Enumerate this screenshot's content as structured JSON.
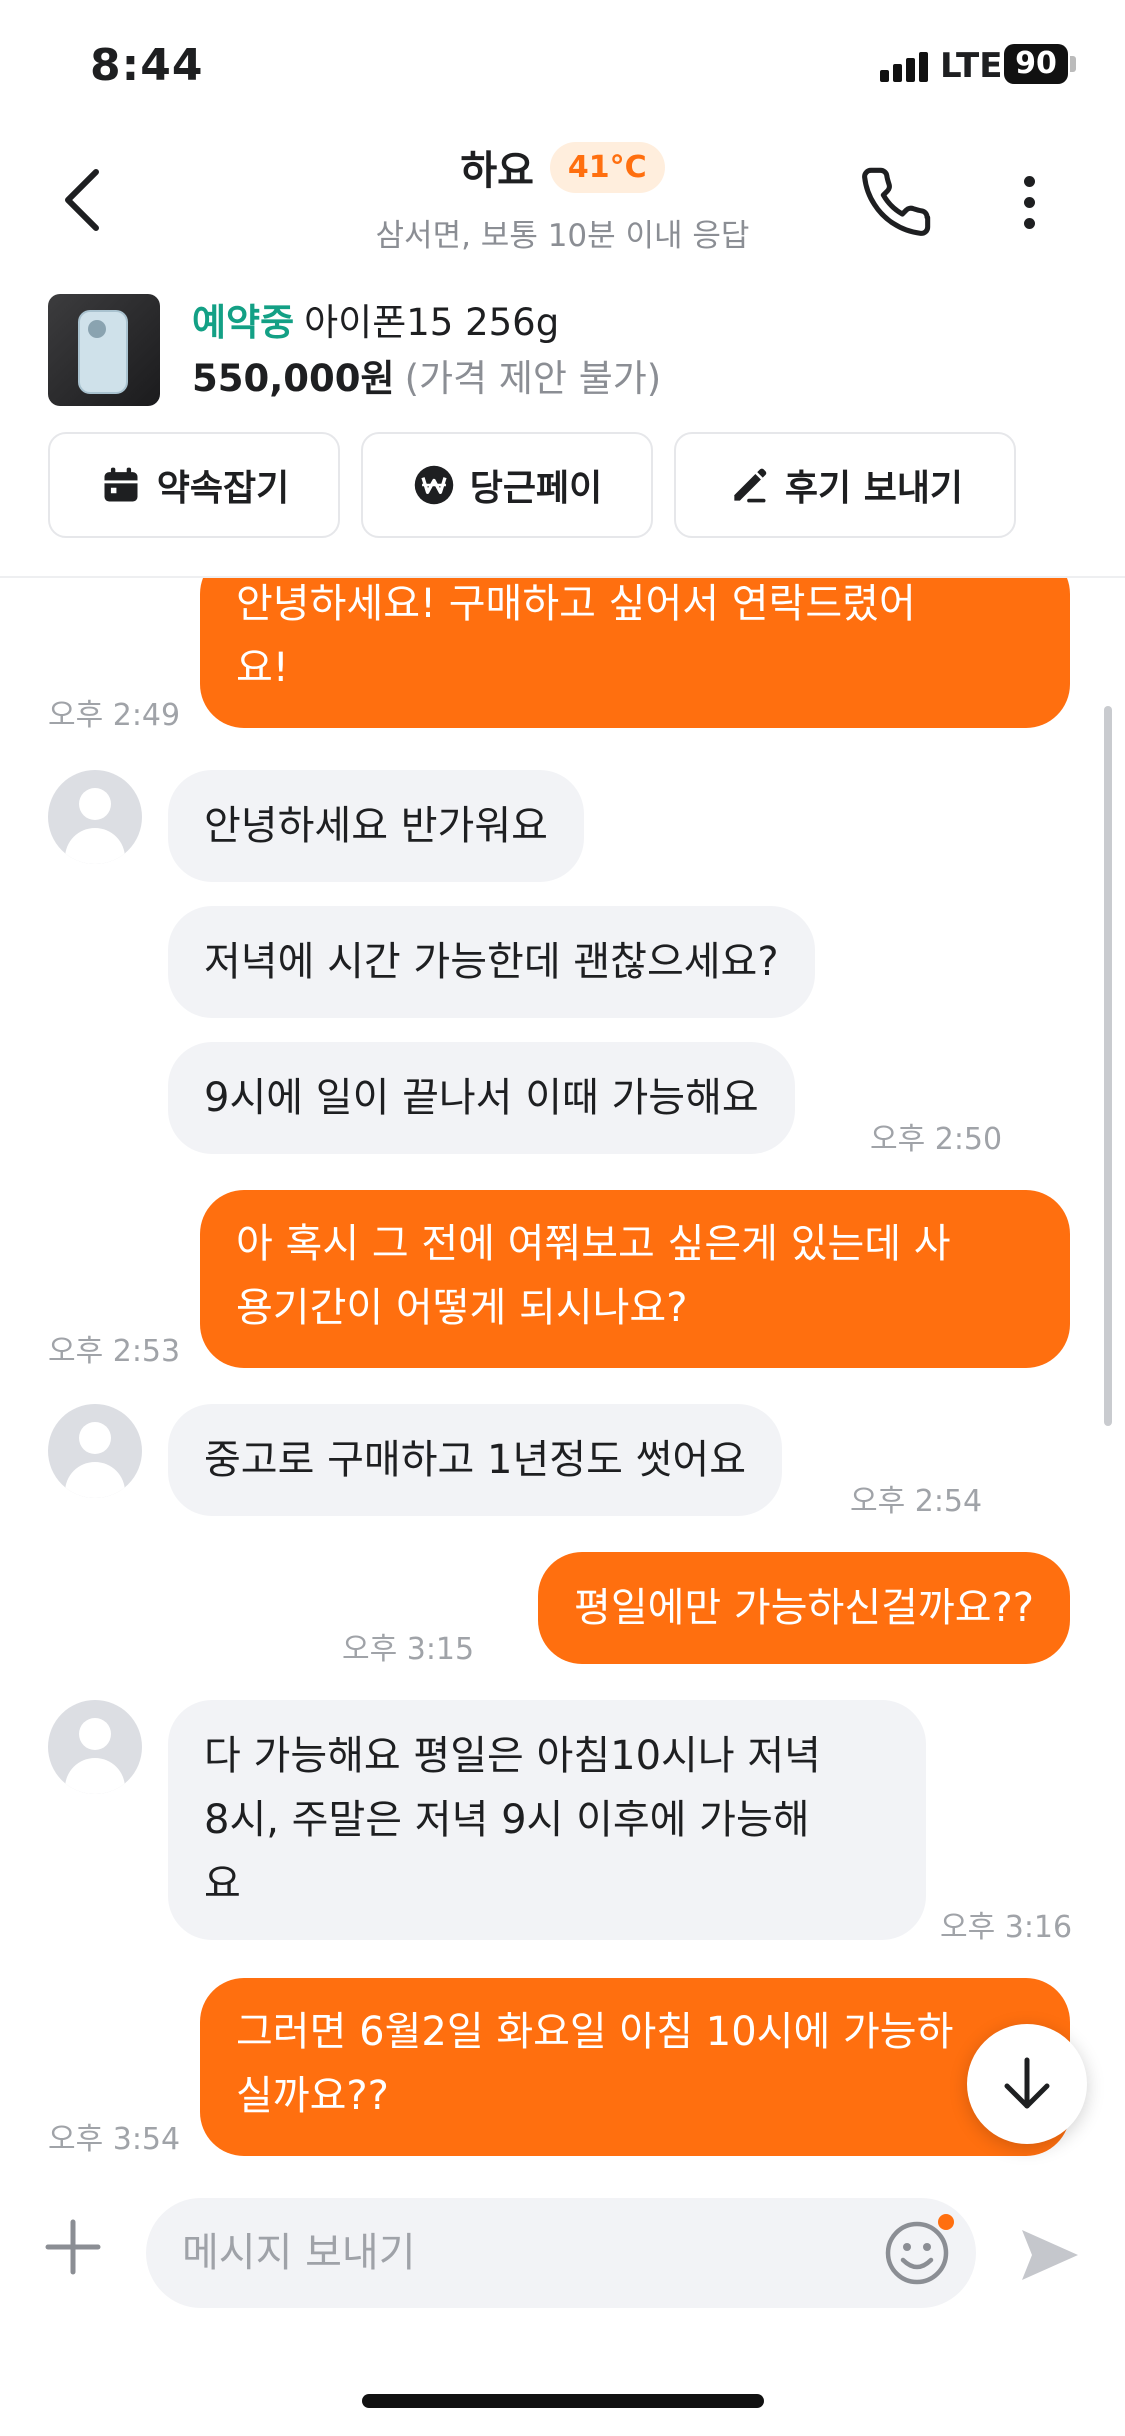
{
  "status_bar": {
    "time": "8:44",
    "network": "LTE",
    "battery": "90"
  },
  "header": {
    "title": "하요",
    "temperature": "41°C",
    "subtitle": "삼서면, 보통 10분 이내 응답",
    "icons": {
      "back": "back-arrow-icon",
      "call": "phone-icon",
      "more": "more-vertical-icon"
    }
  },
  "product": {
    "status": "예약중",
    "name": "아이폰15 256g",
    "price": "550,000원",
    "price_note": "(가격 제안 불가)"
  },
  "actions": [
    {
      "label": "약속잡기",
      "icon": "calendar-icon"
    },
    {
      "label": "당근페이",
      "icon": "won-coin-icon"
    },
    {
      "label": "후기 보내기",
      "icon": "pencil-icon"
    }
  ],
  "messages": [
    {
      "direction": "out",
      "lines": [
        "안녕하세요! 구매하고 싶어서 연락드렸어",
        "요!"
      ],
      "time": "오후 2:49"
    },
    {
      "direction": "in",
      "lines": [
        "안녕하세요 반가워요"
      ],
      "time": ""
    },
    {
      "direction": "in",
      "lines": [
        "저녁에 시간 가능한데 괜찮으세요?"
      ],
      "time": ""
    },
    {
      "direction": "in",
      "lines": [
        "9시에 일이 끝나서 이때 가능해요"
      ],
      "time": "오후 2:50"
    },
    {
      "direction": "out",
      "lines": [
        "아 혹시 그 전에 여쭤보고 싶은게 있는데 사",
        "용기간이 어떻게 되시나요?"
      ],
      "time": "오후 2:53"
    },
    {
      "direction": "in",
      "lines": [
        "중고로 구매하고 1년정도 썻어요"
      ],
      "time": "오후 2:54"
    },
    {
      "direction": "out",
      "lines": [
        "평일에만 가능하신걸까요??"
      ],
      "time": "오후 3:15"
    },
    {
      "direction": "in",
      "lines": [
        "다 가능해요 평일은 아침10시나 저녁",
        "8시, 주말은 저녁 9시 이후에 가능해",
        "요"
      ],
      "time": "오후 3:16"
    },
    {
      "direction": "out",
      "lines": [
        "그러면 6월2일 화요일 아침 10시에 가능하",
        "실까요??"
      ],
      "time": "오후 3:54"
    }
  ],
  "input": {
    "placeholder": "메시지 보내기",
    "icons": {
      "plus": "plus-icon",
      "emoji": "smiley-icon",
      "send": "send-icon",
      "scroll": "arrow-down-icon"
    }
  },
  "colors": {
    "accent": "#ff6f0f",
    "incoming_bubble": "#f2f3f6",
    "reserved_status": "#13a085",
    "muted_text": "#8b8e94"
  }
}
